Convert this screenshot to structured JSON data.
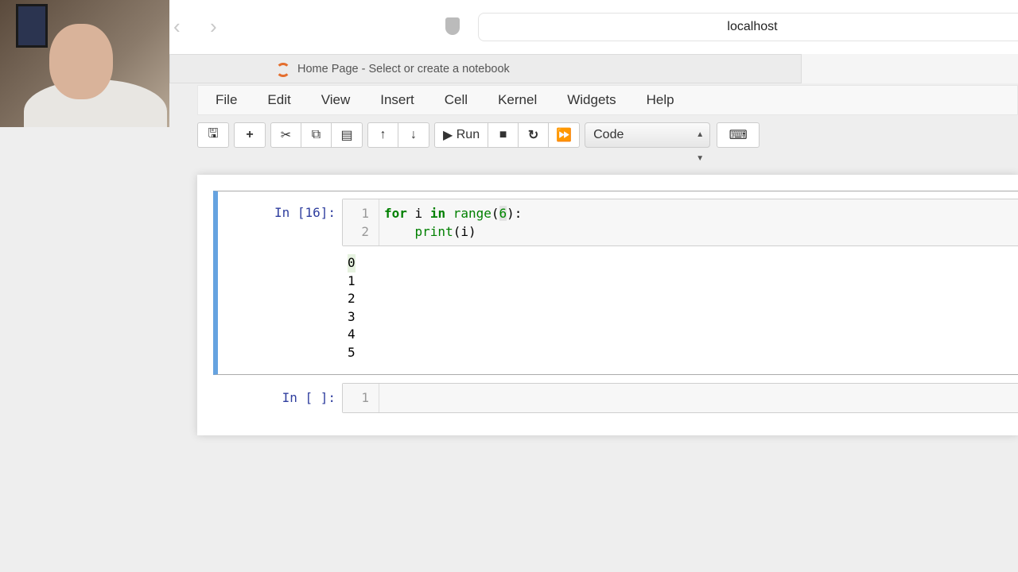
{
  "browser": {
    "url": "localhost",
    "tab_title": "Home Page - Select or create a notebook",
    "back": "‹",
    "forward": "›"
  },
  "menu": [
    "File",
    "Edit",
    "View",
    "Insert",
    "Cell",
    "Kernel",
    "Widgets",
    "Help"
  ],
  "toolbar": {
    "run_label": "Run",
    "cell_type": "Code"
  },
  "cells": [
    {
      "prompt": "In [16]:",
      "line_numbers": [
        "1",
        "2"
      ],
      "code": {
        "kw_for": "for",
        "var": " i ",
        "kw_in": "in",
        "fn": " range",
        "open": "(",
        "num": "6",
        "close": "):",
        "line2_fn": "    print",
        "line2_rest": "(i)"
      },
      "output": [
        "0",
        "1",
        "2",
        "3",
        "4",
        "5"
      ]
    },
    {
      "prompt": "In [ ]:",
      "line_numbers": [
        "1"
      ]
    }
  ],
  "colors": {
    "accent": "#66a3e0",
    "prompt": "#303f9f",
    "keyword": "#008000"
  }
}
